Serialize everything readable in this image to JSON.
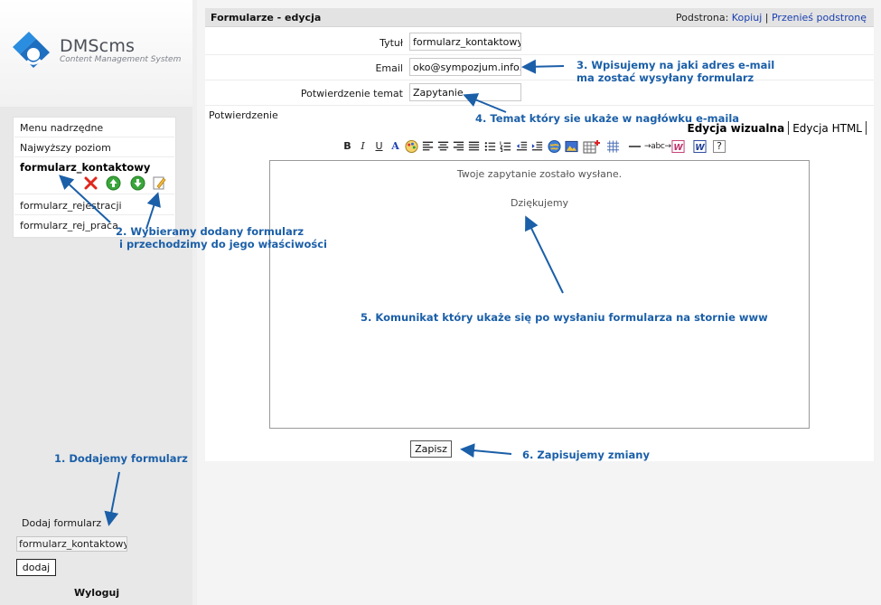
{
  "logo": {
    "title": "DMScms",
    "subtitle": "Content Management System"
  },
  "sidebar": {
    "menu": [
      "Menu nadrzędne",
      "Najwyższy poziom",
      "formularz_kontaktowy",
      "formularz_rejestracji",
      "formularz_rej_praca"
    ],
    "add_label": "Dodaj formularz",
    "add_value": "formularz_kontaktowy",
    "add_button": "dodaj",
    "logout": "Wyloguj"
  },
  "panel": {
    "title": "Formularze - edycja",
    "subpage_label": "Podstrona:",
    "subpage_copy": "Kopiuj",
    "subpage_sep": "|",
    "subpage_move": "Przenieś podstronę"
  },
  "fields": {
    "title_label": "Tytuł",
    "title_value": "formularz_kontaktowy",
    "email_label": "Email",
    "email_value": "oko@sympozjum.info.pl",
    "subject_label": "Potwierdzenie temat",
    "subject_value": "Zapytanie",
    "confirm_label": "Potwierdzenie"
  },
  "editor": {
    "tab_visual": "Edycja wizualna",
    "tab_html": "Edycja HTML",
    "line1": "Twoje zapytanie zostało wysłane.",
    "line2": "Dziękujemy",
    "toolbar": [
      "bold",
      "italic",
      "underline",
      "text-color",
      "palette",
      "align-left",
      "align-center",
      "align-right",
      "justify",
      "bullet-list",
      "numbered-list",
      "outdent",
      "indent",
      "globe-link",
      "image",
      "table-insert",
      "table-grid",
      "horizontal-rule",
      "spellcheck",
      "paste-word",
      "word-doc",
      "help"
    ],
    "toolbar_text": {
      "bold": "B",
      "italic": "I",
      "underline": "U",
      "text_color": "A",
      "spellcheck": "abc",
      "help": "?"
    }
  },
  "save_button": "Zapisz",
  "annotations": {
    "n1": "1. Dodajemy  formularz",
    "n2a": "2. Wybieramy dodany formularz",
    "n2b": "i przechodzimy do jego właściwości",
    "n3a": "3. Wpisujemy na jaki adres e-mail",
    "n3b": "ma zostać wysyłany formularz",
    "n4": "4. Temat który sie ukaże w nagłówku e-maila",
    "n5": "5. Komunikat który ukaże się po wysłaniu formularza na stornie www",
    "n6": "6. Zapisujemy zmiany"
  },
  "colors": {
    "annotation": "#1b5fa8",
    "link": "#1a3fb0",
    "logo_blue": "#2a8de0"
  }
}
